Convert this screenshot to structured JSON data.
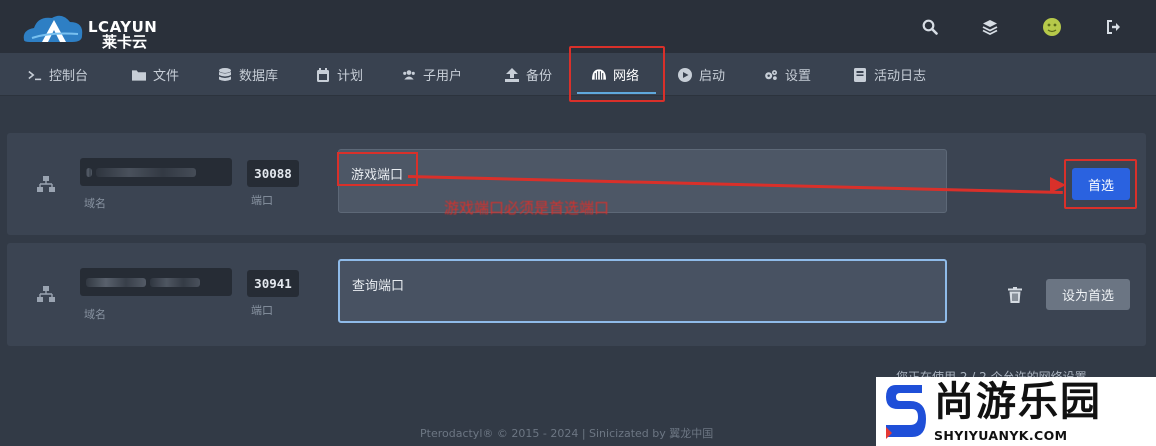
{
  "header": {
    "logo_text": "LCAYUN",
    "logo_sub": "莱卡云",
    "icons": [
      "search-icon",
      "layers-icon",
      "avatar",
      "logout-icon"
    ]
  },
  "nav": {
    "items": [
      {
        "label": "控制台",
        "icon": "terminal-icon"
      },
      {
        "label": "文件",
        "icon": "folder-icon"
      },
      {
        "label": "数据库",
        "icon": "database-icon"
      },
      {
        "label": "计划",
        "icon": "calendar-icon"
      },
      {
        "label": "子用户",
        "icon": "users-icon"
      },
      {
        "label": "备份",
        "icon": "upload-icon"
      },
      {
        "label": "网络",
        "icon": "network-icon",
        "active": true
      },
      {
        "label": "启动",
        "icon": "play-icon"
      },
      {
        "label": "设置",
        "icon": "gears-icon"
      },
      {
        "label": "活动日志",
        "icon": "book-icon"
      }
    ]
  },
  "allocations": [
    {
      "domain_label": "域名",
      "port": "30088",
      "port_label": "端口",
      "notes": "游戏端口",
      "action": "首选"
    },
    {
      "domain_label": "域名",
      "port": "30941",
      "port_label": "端口",
      "notes": "查询端口",
      "action": "设为首选"
    }
  ],
  "annotation": "游戏端口必须是首选端口",
  "usage_text": "您正在使用 2 / 2 个允许的网络设置。",
  "footer": "Pterodactyl® © 2015 - 2024 | Sinicizated by 翼龙中国",
  "watermark": {
    "title": "尚游乐园",
    "url": "SHYIYUANYK.COM"
  },
  "colors": {
    "accent": "#5fa8dc",
    "primary_button": "#2a62e0",
    "annotation_red": "#d9302a"
  }
}
